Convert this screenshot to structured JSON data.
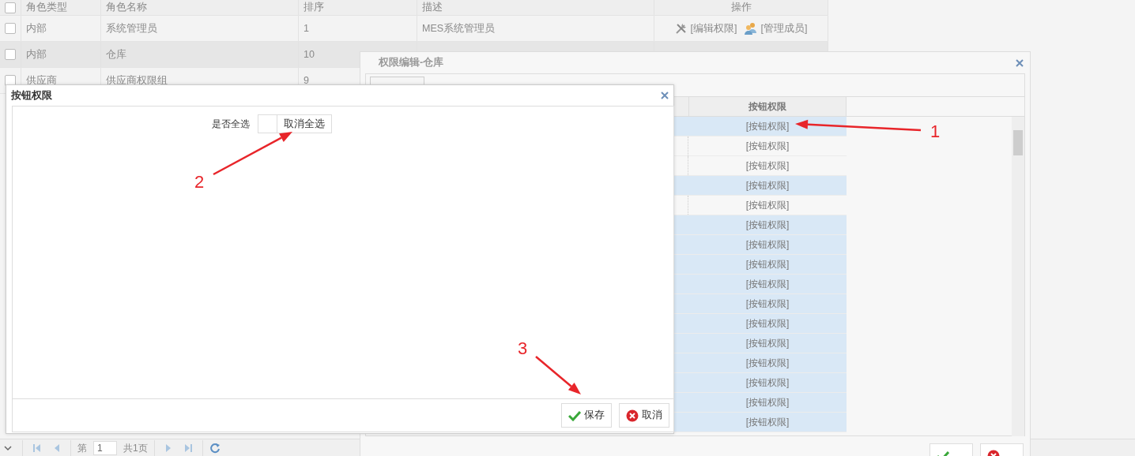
{
  "grid": {
    "header_checked": false,
    "columns": [
      "角色类型",
      "角色名称",
      "排序",
      "描述",
      "操作"
    ],
    "rows": [
      {
        "selected": false,
        "checked": false,
        "cells": [
          "内部",
          "系统管理员",
          "1",
          "MES系统管理员"
        ],
        "actions": [
          {
            "kind": "edit",
            "label": "[编辑权限]"
          },
          {
            "kind": "members",
            "label": "[管理成员]"
          }
        ]
      },
      {
        "selected": true,
        "checked": false,
        "cells": [
          "内部",
          "仓库",
          "10"
        ]
      },
      {
        "selected": false,
        "checked": false,
        "cells": [
          "供应商",
          "供应商权限组",
          "9"
        ]
      }
    ]
  },
  "pager": {
    "page_prefix": "第",
    "page": "1",
    "total": "共1页"
  },
  "edit_dialog": {
    "title": "权限编辑-仓库",
    "column": "按钮权限",
    "rows": [
      {
        "text": "[按钮权限]",
        "selected": true
      },
      {
        "text": "[按钮权限]",
        "selected": false
      },
      {
        "text": "[按钮权限]",
        "selected": false
      },
      {
        "text": "[按钮权限]",
        "selected": true
      },
      {
        "text": "[按钮权限]",
        "selected": false
      },
      {
        "text": "[按钮权限]",
        "selected": true
      },
      {
        "text": "[按钮权限]",
        "selected": true
      },
      {
        "text": "[按钮权限]",
        "selected": true
      },
      {
        "text": "[按钮权限]",
        "selected": true
      },
      {
        "text": "[按钮权限]",
        "selected": true
      },
      {
        "text": "[按钮权限]",
        "selected": true
      },
      {
        "text": "[按钮权限]",
        "selected": true
      },
      {
        "text": "[按钮权限]",
        "selected": true
      },
      {
        "text": "[按钮权限]",
        "selected": true
      },
      {
        "text": "[按钮权限]",
        "selected": true
      },
      {
        "text": "[按钮权限]",
        "selected": true
      }
    ],
    "buttons": [
      {
        "kind": "save"
      },
      {
        "kind": "cancel"
      }
    ]
  },
  "button_dialog": {
    "title": "按钮权限",
    "select_all": {
      "label": "是否全选",
      "checked": false
    },
    "clear_button": "取消全选",
    "buttons": [
      {
        "kind": "save",
        "label": "保存"
      },
      {
        "kind": "cancel",
        "label": "取消"
      }
    ]
  },
  "annotations": [
    {
      "label": "1"
    },
    {
      "label": "2"
    },
    {
      "label": "3"
    }
  ]
}
